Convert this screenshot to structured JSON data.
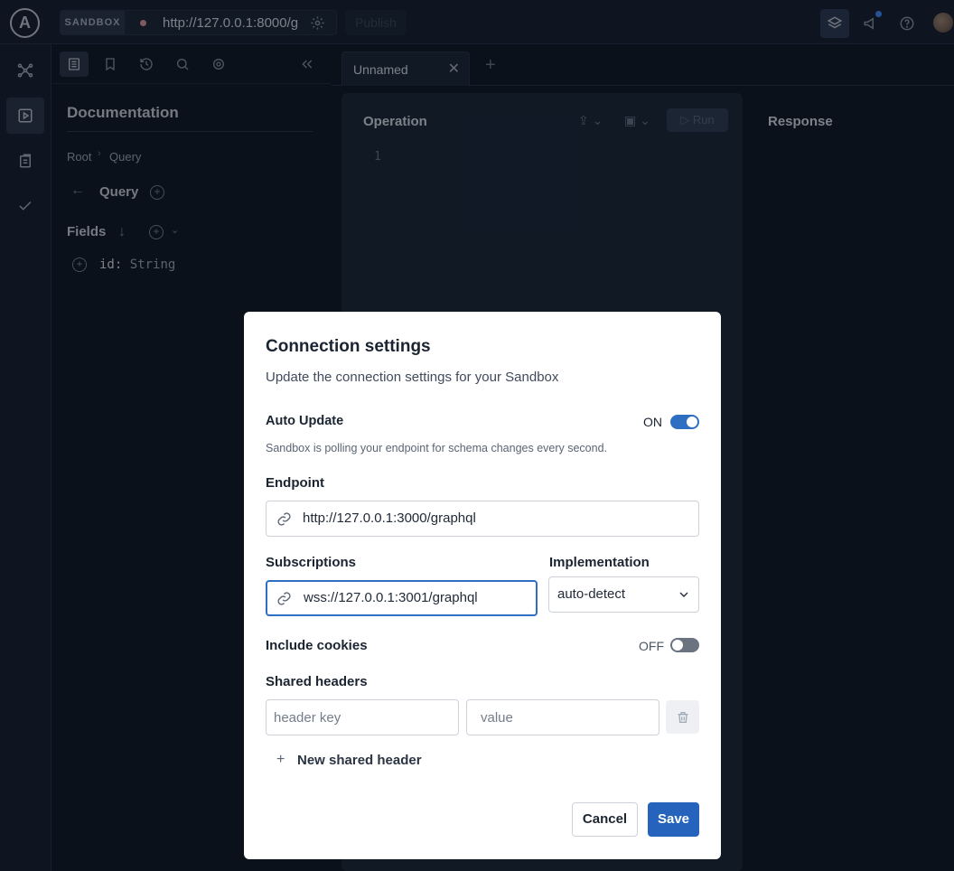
{
  "topbar": {
    "environment_tag": "SANDBOX",
    "endpoint_url": "http://127.0.0.1:8000/g",
    "publish_label": "Publish"
  },
  "doc_panel": {
    "title": "Documentation",
    "breadcrumb": [
      "Root",
      "Query"
    ],
    "type_name": "Query",
    "fields_heading": "Fields",
    "fields": [
      {
        "name": "id:",
        "type": "String"
      }
    ]
  },
  "editor": {
    "tab_label": "Unnamed",
    "operation_title": "Operation",
    "run_label": "Run",
    "line_number": "1",
    "response_title": "Response"
  },
  "modal": {
    "title": "Connection settings",
    "subtitle": "Update the connection settings for your Sandbox",
    "auto_update": {
      "label": "Auto Update",
      "state": "ON",
      "on": true,
      "help": "Sandbox is polling your endpoint for schema changes every second."
    },
    "endpoint": {
      "label": "Endpoint",
      "value": "http://127.0.0.1:3000/graphql"
    },
    "subscriptions": {
      "label": "Subscriptions",
      "value": "wss://127.0.0.1:3001/graphql"
    },
    "implementation": {
      "label": "Implementation",
      "value": "auto-detect"
    },
    "include_cookies": {
      "label": "Include cookies",
      "state": "OFF",
      "on": false
    },
    "shared_headers": {
      "label": "Shared headers",
      "key_placeholder": "header key",
      "value_placeholder": "value",
      "add_label": "New shared header"
    },
    "cancel_label": "Cancel",
    "save_label": "Save"
  },
  "colors": {
    "accent": "#2563bd",
    "toggle_on": "#2f6fc2",
    "background": "#0f1623"
  }
}
